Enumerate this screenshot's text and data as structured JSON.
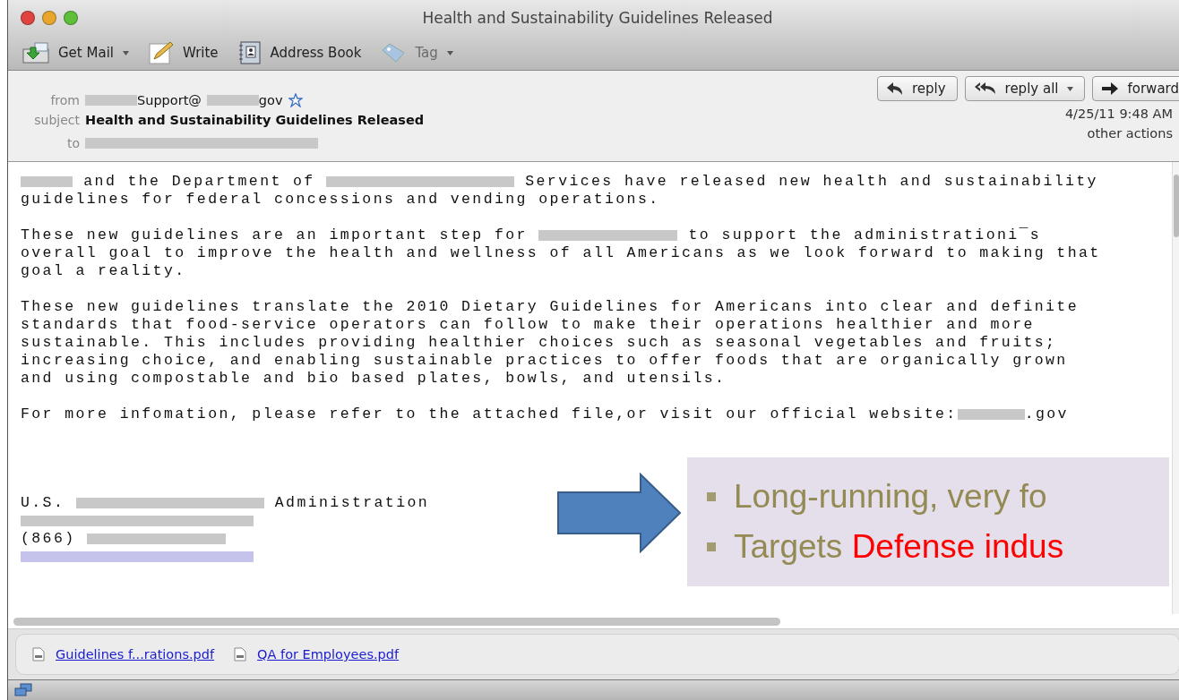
{
  "window": {
    "title": "Health and Sustainability Guidelines Released"
  },
  "toolbar": [
    {
      "label": "Get Mail",
      "caret": true,
      "disabled": false
    },
    {
      "label": "Write",
      "caret": false,
      "disabled": false
    },
    {
      "label": "Address Book",
      "caret": false,
      "disabled": false
    },
    {
      "label": "Tag",
      "caret": true,
      "disabled": true
    }
  ],
  "header": {
    "from_label": "from",
    "from": [
      {
        "kind": "redacted-narrow"
      },
      {
        "kind": "text",
        "text": "Support@"
      },
      {
        "kind": "redacted-narrow"
      },
      {
        "kind": "text",
        "text": "gov"
      }
    ],
    "subject_label": "subject",
    "subject": "Health and Sustainability Guidelines Released",
    "to_label": "to",
    "to": [
      {
        "kind": "redacted-wide"
      }
    ],
    "actions": [
      {
        "label": "reply",
        "caret": false
      },
      {
        "label": "reply all",
        "caret": true
      },
      {
        "label": "forward",
        "caret": false
      }
    ],
    "date": "4/25/11 9:48 AM",
    "other_actions": "other actions"
  },
  "body": {
    "paragraphs": [
      [
        [
          {
            "kind": "redacted-narrow"
          },
          {
            "kind": "text",
            "text": " and the Department of "
          },
          {
            "kind": "redacted-long"
          },
          {
            "kind": "text",
            "text": " Services have released new health and sustainability"
          }
        ],
        [
          {
            "kind": "text",
            "text": "guidelines for federal concessions and vending operations."
          }
        ]
      ],
      [
        [
          {
            "kind": "text",
            "text": "These new guidelines are an important step for "
          },
          {
            "kind": "redacted"
          },
          {
            "kind": "text",
            "text": " to support the administrationi¯s"
          }
        ],
        [
          {
            "kind": "text",
            "text": "overall goal to improve the health and wellness of all Americans as we look forward to making that"
          }
        ],
        [
          {
            "kind": "text",
            "text": "goal a reality."
          }
        ]
      ],
      [
        [
          {
            "kind": "text",
            "text": "These new guidelines translate the 2010 Dietary Guidelines for Americans into clear and definite"
          }
        ],
        [
          {
            "kind": "text",
            "text": "standards that food-service operators can follow to make their operations healthier and more"
          }
        ],
        [
          {
            "kind": "text",
            "text": "sustainable. This includes providing healthier choices such as seasonal vegetables and fruits;"
          }
        ],
        [
          {
            "kind": "text",
            "text": "increasing choice, and enabling sustainable practices to offer foods that are organically grown"
          }
        ],
        [
          {
            "kind": "text",
            "text": "and using compostable and bio based plates, bowls, and utensils."
          }
        ]
      ],
      [
        [
          {
            "kind": "text",
            "text": "For more infomation, please refer to the attached file,or visit our official website:"
          },
          {
            "kind": "redacted-small"
          },
          {
            "kind": "text",
            "text": ".gov"
          }
        ]
      ]
    ],
    "signature": [
      [
        {
          "kind": "text",
          "text": "U.S. "
        },
        {
          "kind": "redacted-long"
        },
        {
          "kind": "text",
          "text": " Administration"
        }
      ],
      [
        {
          "kind": "redacted-wide"
        }
      ],
      [
        {
          "kind": "text",
          "text": "(866) "
        },
        {
          "kind": "redacted"
        }
      ],
      [
        {
          "kind": "redacted-link"
        }
      ]
    ]
  },
  "attachments": [
    {
      "name": "Guidelines f...rations.pdf"
    },
    {
      "name": "QA for Employees.pdf"
    }
  ],
  "overlay": {
    "bullets": [
      [
        {
          "text": "Long-running, very fo",
          "emphasis": false
        }
      ],
      [
        {
          "text": "Targets ",
          "emphasis": false
        },
        {
          "text": "Defense indus",
          "emphasis": true
        }
      ]
    ]
  }
}
